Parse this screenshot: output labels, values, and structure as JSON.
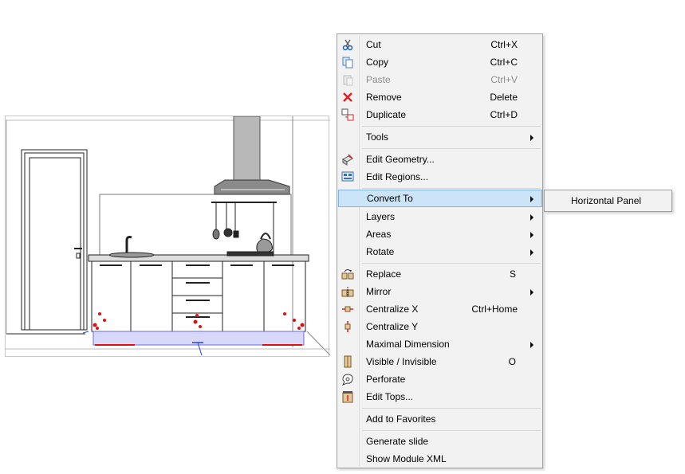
{
  "menu": {
    "items": [
      {
        "label": "Cut",
        "shortcut": "Ctrl+X",
        "icon": "scissors-icon"
      },
      {
        "label": "Copy",
        "shortcut": "Ctrl+C",
        "icon": "copy-icon"
      },
      {
        "label": "Paste",
        "shortcut": "Ctrl+V",
        "icon": "paste-icon",
        "disabled": true
      },
      {
        "label": "Remove",
        "shortcut": "Delete",
        "icon": "delete-x-icon"
      },
      {
        "label": "Duplicate",
        "shortcut": "Ctrl+D",
        "icon": "duplicate-icon"
      },
      {
        "label": "Tools",
        "submenu": true
      },
      {
        "label": "Edit Geometry...",
        "icon": "edit-geometry-icon"
      },
      {
        "label": "Edit Regions...",
        "icon": "edit-regions-icon"
      },
      {
        "label": "Convert To",
        "submenu": true,
        "active": true
      },
      {
        "label": "Layers",
        "submenu": true
      },
      {
        "label": "Areas",
        "submenu": true
      },
      {
        "label": "Rotate",
        "submenu": true
      },
      {
        "label": "Replace",
        "shortcut": "S",
        "icon": "replace-icon"
      },
      {
        "label": "Mirror",
        "submenu": true,
        "icon": "mirror-icon"
      },
      {
        "label": "Centralize X",
        "shortcut": "Ctrl+Home",
        "icon": "centralize-x-icon"
      },
      {
        "label": "Centralize Y",
        "icon": "centralize-y-icon"
      },
      {
        "label": "Maximal Dimension",
        "submenu": true
      },
      {
        "label": "Visible / Invisible",
        "shortcut": "O",
        "icon": "visibility-icon"
      },
      {
        "label": "Perforate",
        "icon": "perforate-icon"
      },
      {
        "label": "Edit Tops...",
        "icon": "edit-tops-icon"
      },
      {
        "label": "Add to Favorites"
      },
      {
        "label": "Generate slide"
      },
      {
        "label": "Show Module XML"
      }
    ]
  },
  "submenu": {
    "items": [
      {
        "label": "Horizontal Panel"
      }
    ]
  },
  "colors": {
    "menu_bg": "#f2f2f2",
    "highlight": "#cce4f7",
    "highlight_border": "#7eb4ea",
    "selection": "#d8d8fa",
    "marker_red": "#e01010"
  }
}
